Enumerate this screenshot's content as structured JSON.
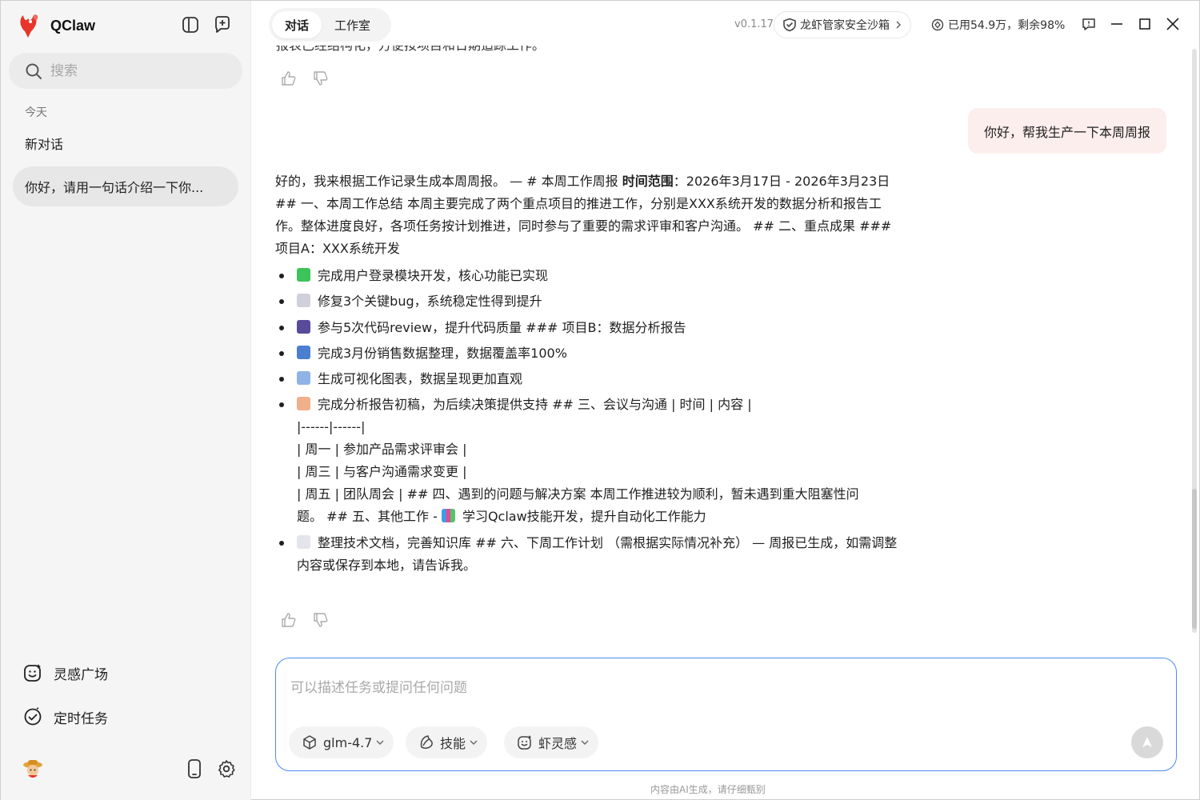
{
  "app": {
    "name": "QClaw",
    "version": "v0.1.17"
  },
  "sidebar": {
    "search_placeholder": "搜索",
    "section_today": "今天",
    "conversations": [
      {
        "label": "新对话",
        "active": false
      },
      {
        "label": "你好，请用一句话介绍一下你...",
        "active": true
      }
    ],
    "links": [
      {
        "label": "灵感广场",
        "icon": "inspiration-smile-icon"
      },
      {
        "label": "定时任务",
        "icon": "scheduled-check-icon"
      }
    ]
  },
  "header": {
    "tabs": [
      {
        "label": "对话",
        "active": true
      },
      {
        "label": "工作室",
        "active": false
      }
    ],
    "sandbox_label": "龙虾管家安全沙箱",
    "usage_label": "已用54.9万，剩余98%"
  },
  "chat": {
    "cut_text": "报表已经结构化，方便按项目和日期追踪工作。",
    "user_message": "你好，帮我生产一下本周周报",
    "answer_intro_a": "好的，我来根据工作记录生成本周周报。 — # 本周工作周报 ",
    "answer_intro_bold": "时间范围",
    "answer_intro_b": "：2026年3月17日 - 2026年3月23日 ## 一、本周工作总结 本周主要完成了两个重点项目的推进工作，分别是XXX系统开发的数据分析和报告工作。整体进度良好，各项任务按计划推进，同时参与了重要的需求评审和客户沟通。 ## 二、重点成果 ### 项目A：XXX系统开发",
    "bullets": [
      {
        "emoji_color": "#3cc35a",
        "text": "完成用户登录模块开发，核心功能已实现"
      },
      {
        "emoji_color": "#b8b8c8",
        "text": "修复3个关键bug，系统稳定性得到提升"
      },
      {
        "emoji_color": "#5a4a9a",
        "text": "参与5次代码review，提升代码质量 ### 项目B：数据分析报告"
      },
      {
        "emoji_color": "#4a7fd0",
        "text": "完成3月份销售数据整理，数据覆盖率100%"
      },
      {
        "emoji_color": "#6a9ad8",
        "text": "生成可视化图表，数据呈现更加直观"
      }
    ],
    "bullet6_lines": [
      "完成分析报告初稿，为后续决策提供支持 ## 三、会议与沟通 | 时间 | 内容 |",
      "|------|------|",
      "| 周一 | 参加产品需求评审会 |",
      "| 周三 | 与客户沟通需求变更 |",
      "| 周五 | 团队周会 | ## 四、遇到的问题与解决方案 本周工作推进较为顺利，暂未遇到重大阻塞性问",
      "题。 ## 五、其他工作 - ",
      "学习Qclaw技能开发，提升自动化工作能力"
    ],
    "bullet7_text": "整理技术文档，完善知识库 ## 六、下周工作计划 （需根据实际情况补充） — 周报已生成，如需调整内容或保存到本地，请告诉我。"
  },
  "composer": {
    "placeholder": "可以描述任务或提问任何问题",
    "model": "glm-4.7",
    "skills": "技能",
    "inspiration": "虾灵感"
  },
  "footer_note": "内容由AI生成，请仔细甄别",
  "colors": {
    "accent": "#4a8cf0",
    "user_bubble": "#fdeeee",
    "sidebar_bg": "#f5f5f5"
  }
}
